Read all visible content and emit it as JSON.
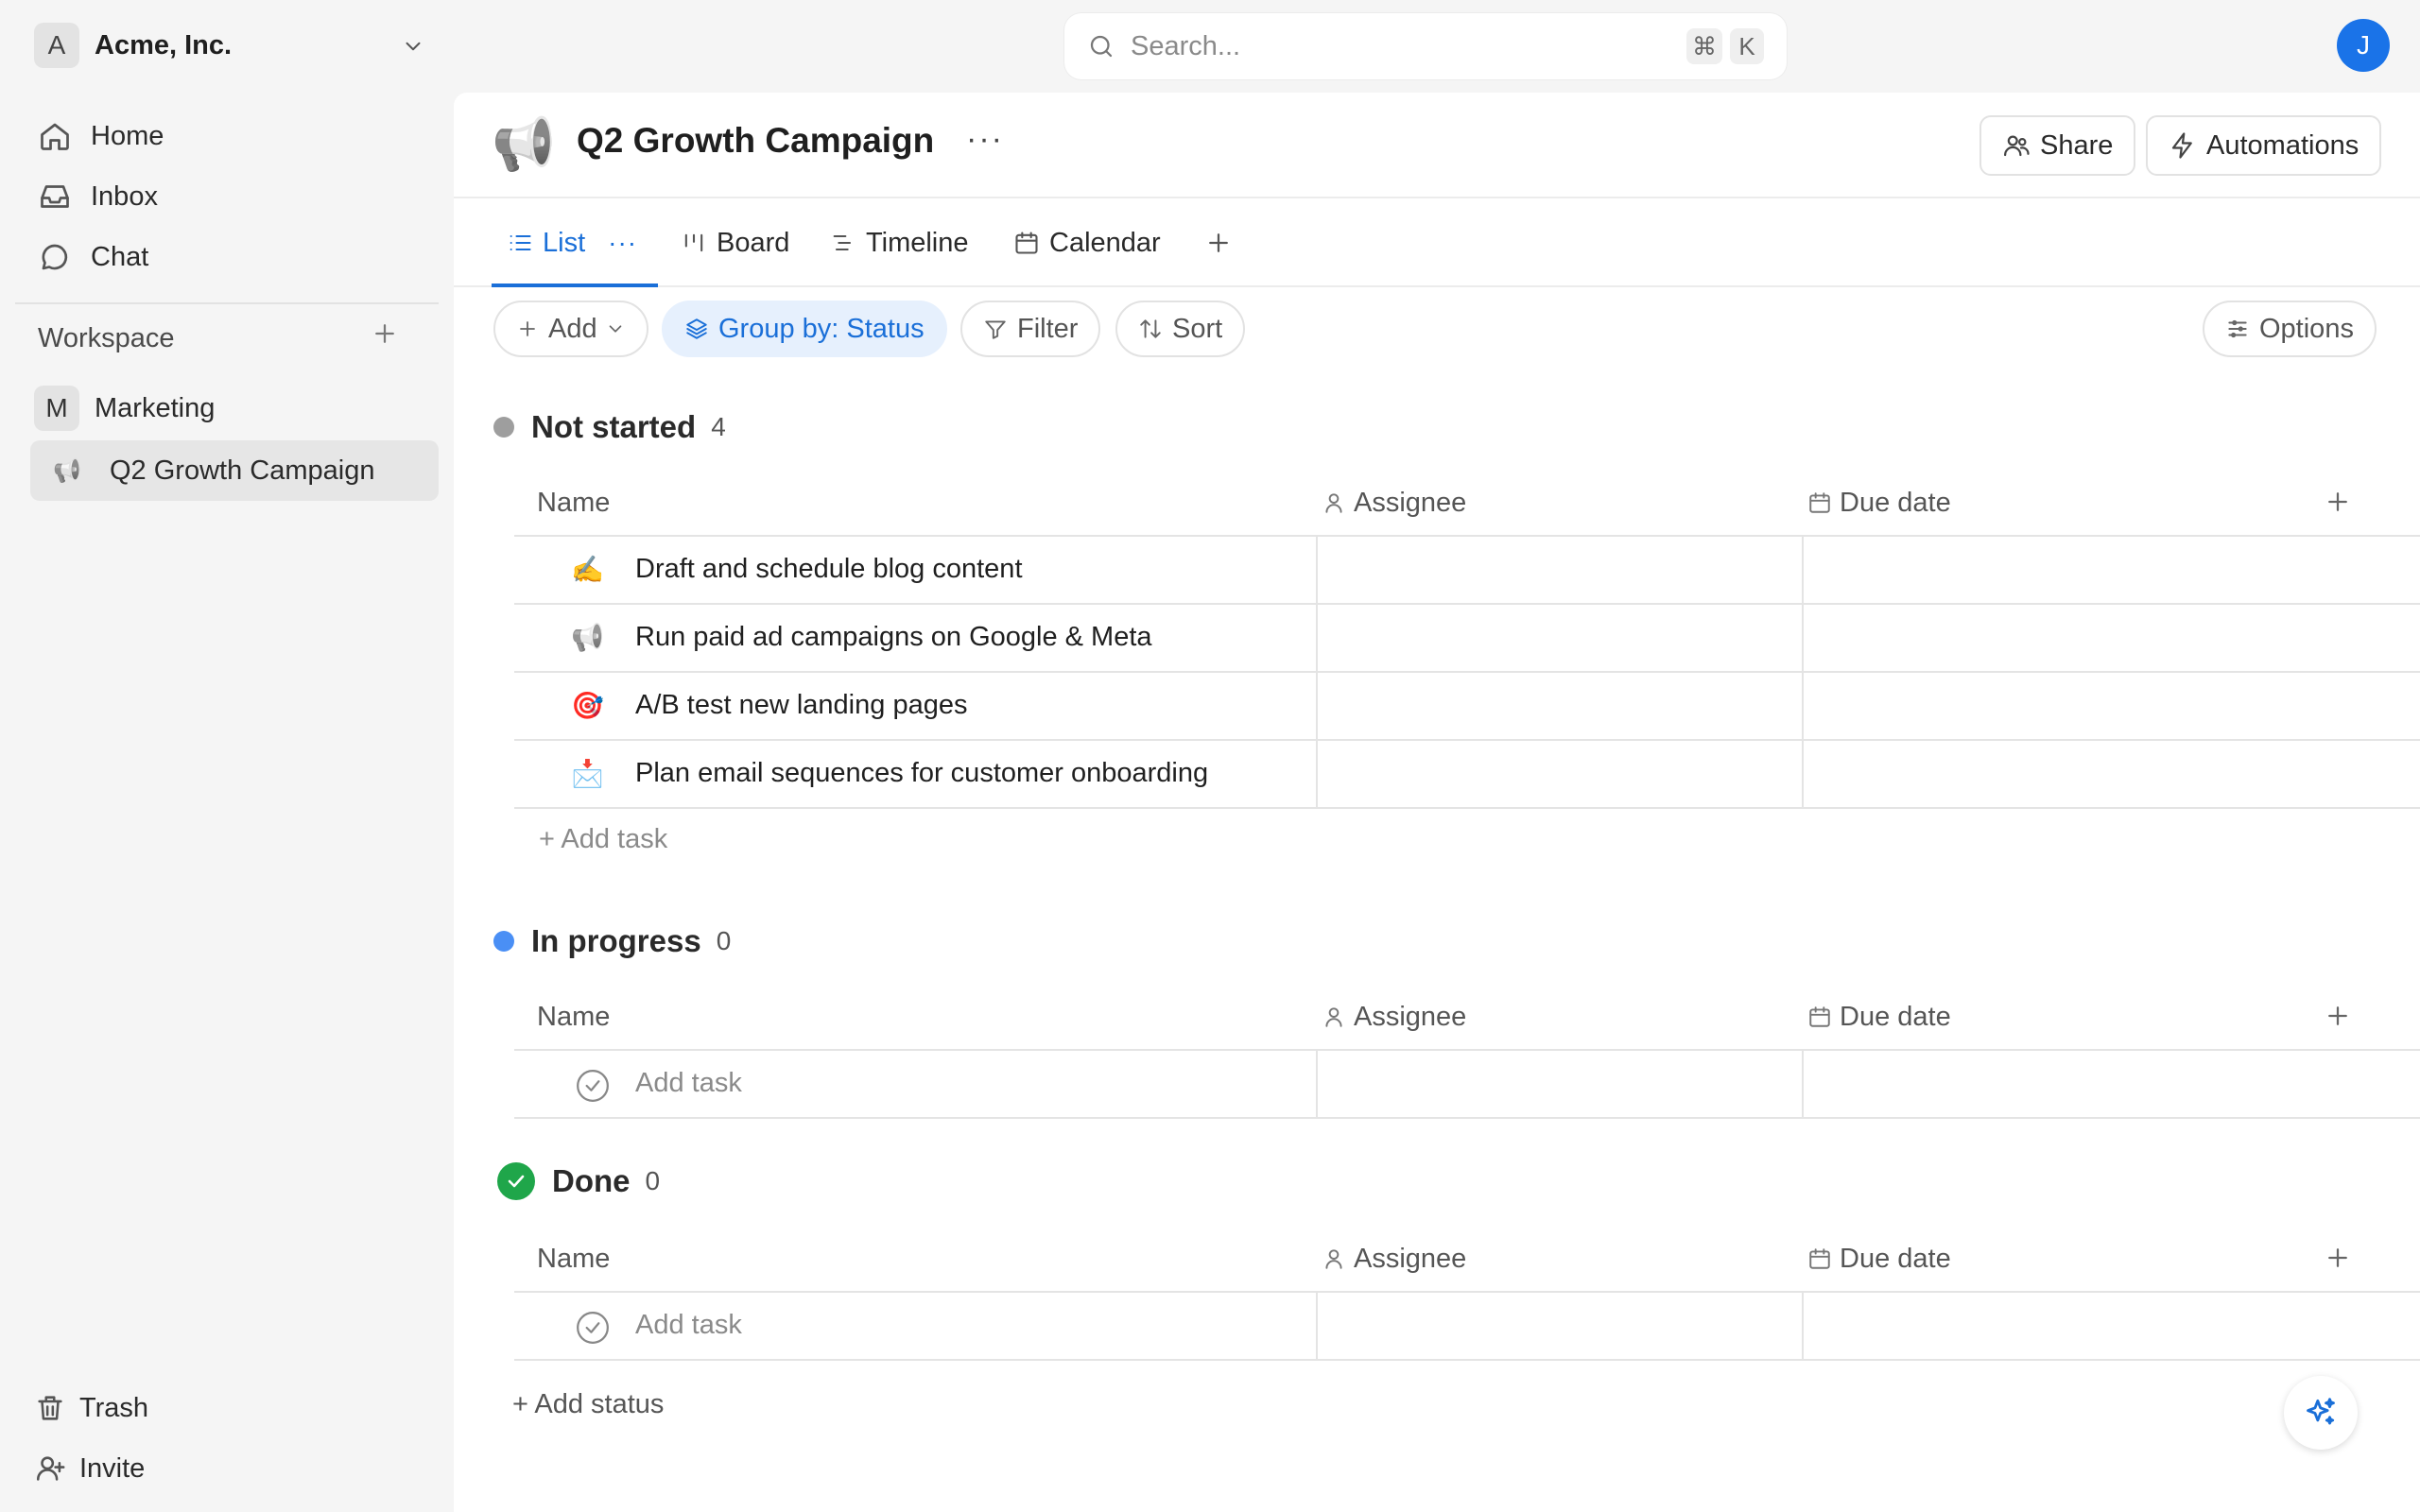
{
  "org": {
    "initial": "A",
    "name": "Acme, Inc."
  },
  "search": {
    "placeholder": "Search...",
    "kbd_cmd": "⌘",
    "kbd_key": "K"
  },
  "user": {
    "initial": "J"
  },
  "nav": {
    "home": "Home",
    "inbox": "Inbox",
    "chat": "Chat"
  },
  "workspace": {
    "label": "Workspace",
    "team": {
      "initial": "M",
      "name": "Marketing"
    },
    "project": {
      "emoji": "📢",
      "name": "Q2 Growth Campaign"
    }
  },
  "bottom_nav": {
    "trash": "Trash",
    "invite": "Invite"
  },
  "page": {
    "emoji": "📢",
    "title": "Q2 Growth Campaign",
    "more": "···"
  },
  "header_buttons": {
    "share": "Share",
    "automations": "Automations"
  },
  "tabs": {
    "list": "List",
    "list_more": "···",
    "board": "Board",
    "timeline": "Timeline",
    "calendar": "Calendar"
  },
  "toolbar": {
    "add": "Add",
    "group_by": "Group by: Status",
    "filter": "Filter",
    "sort": "Sort",
    "options": "Options"
  },
  "columns": {
    "name": "Name",
    "assignee": "Assignee",
    "due_date": "Due date"
  },
  "groups": [
    {
      "name": "Not started",
      "count": "4",
      "color": "#9e9e9e",
      "tasks": [
        {
          "emoji": "✍️",
          "name": "Draft and schedule blog content"
        },
        {
          "emoji": "📢",
          "name": "Run paid ad campaigns on Google & Meta"
        },
        {
          "emoji": "🎯",
          "name": "A/B test new landing pages"
        },
        {
          "emoji": "📩",
          "name": "Plan email sequences for customer onboarding"
        }
      ],
      "add_task": "+ Add task"
    },
    {
      "name": "In progress",
      "count": "0",
      "color": "#4a8ff5",
      "empty_add": "Add task"
    },
    {
      "name": "Done",
      "count": "0",
      "color": "#1fa64a",
      "empty_add": "Add task"
    }
  ],
  "add_status": "+ Add status",
  "colors": {
    "accent": "#1a6fd8",
    "done": "#1fa64a"
  }
}
